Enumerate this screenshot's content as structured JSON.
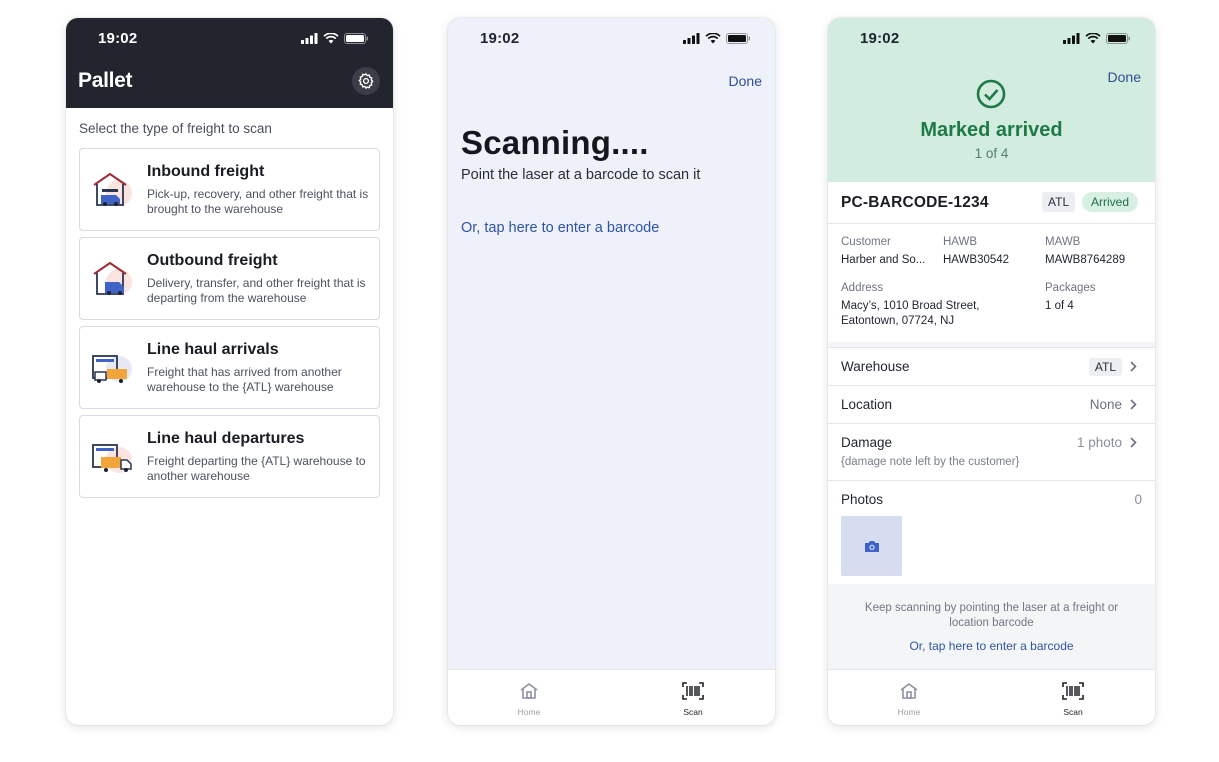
{
  "status_time": "19:02",
  "colors": {
    "dark_header": "#23252e",
    "link_blue": "#2f55a4",
    "success_green": "#1f7a47",
    "banner_green": "#d3ece0",
    "scan_bg": "#eef0fa"
  },
  "screen1": {
    "app_title": "Pallet",
    "settings_icon": "gear-icon",
    "subtitle": "Select the type of freight to scan",
    "cards": [
      {
        "title": "Inbound freight",
        "desc": "Pick-up, recovery, and other freight that is brought to the warehouse",
        "icon": "warehouse-van-icon"
      },
      {
        "title": "Outbound freight",
        "desc": "Delivery, transfer, and other freight that is departing from the warehouse",
        "icon": "warehouse-van-out-icon"
      },
      {
        "title": "Line haul arrivals",
        "desc": "Freight that has arrived from another warehouse to the {ATL} warehouse",
        "icon": "truck-arrival-icon"
      },
      {
        "title": "Line haul departures",
        "desc": "Freight departing the {ATL} warehouse to another warehouse",
        "icon": "truck-departure-icon"
      }
    ]
  },
  "screen2": {
    "done": "Done",
    "title": "Scanning....",
    "subtitle": "Point the laser at a barcode to scan it",
    "link": "Or, tap here to enter a barcode"
  },
  "tabs": {
    "home": "Home",
    "scan": "Scan"
  },
  "screen3": {
    "done": "Done",
    "banner_title": "Marked arrived",
    "banner_count": "1 of 4",
    "barcode": "PC-BARCODE-1234",
    "tag_location": "ATL",
    "tag_status": "Arrived",
    "fields": {
      "customer_label": "Customer",
      "customer_value": "Harber and So...",
      "hawb_label": "HAWB",
      "hawb_value": "HAWB30542",
      "mawb_label": "MAWB",
      "mawb_value": "MAWB8764289",
      "address_label": "Address",
      "address_line1": "Macy’s, 1010 Broad Street,",
      "address_line2": "Eatontown, 07724, NJ",
      "packages_label": "Packages",
      "packages_value": "1 of 4"
    },
    "rows": {
      "warehouse_label": "Warehouse",
      "warehouse_value": "ATL",
      "location_label": "Location",
      "location_value": "None",
      "damage_label": "Damage",
      "damage_value": "1 photo",
      "damage_note": "{damage note left by the customer}",
      "photos_label": "Photos",
      "photos_count": "0"
    },
    "keep_text": "Keep scanning by pointing the laser at a freight or location barcode",
    "keep_link": "Or, tap here to enter a barcode"
  }
}
